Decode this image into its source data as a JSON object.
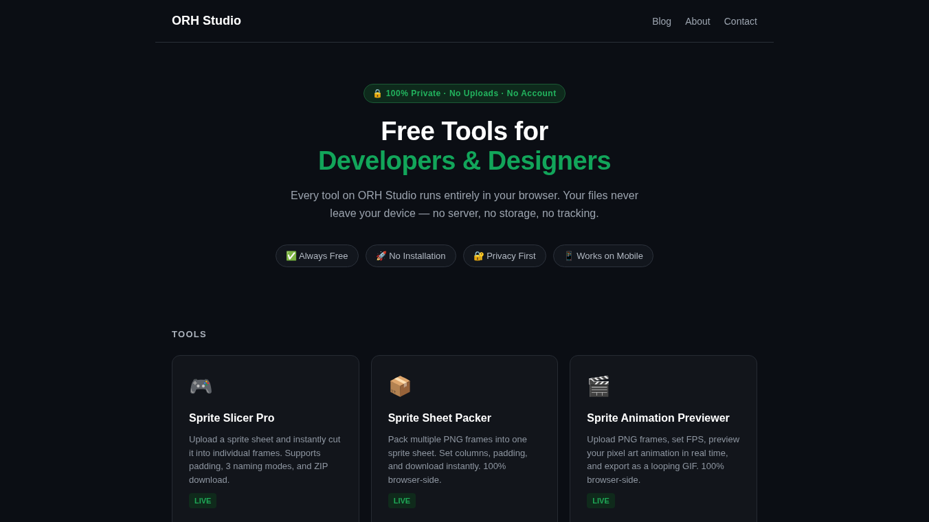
{
  "header": {
    "logo": "ORH Studio",
    "nav": [
      "Blog",
      "About",
      "Contact"
    ]
  },
  "hero": {
    "badge": "🔒 100% Private · No Uploads · No Account",
    "title": "Free Tools for",
    "title_accent": "Developers & Designers",
    "lead": "Every tool on ORH Studio runs entirely in your browser. Your files never leave your device — no server, no storage, no tracking.",
    "pills": [
      "✅ Always Free",
      "🚀 No Installation",
      "🔐 Privacy First",
      "📱 Works on Mobile"
    ]
  },
  "tools": {
    "heading": "TOOLS",
    "cards": [
      {
        "icon": "🎮",
        "title": "Sprite Slicer Pro",
        "description": "Upload a sprite sheet and instantly cut it into individual frames. Supports padding, 3 naming modes, and ZIP download.",
        "status": "LIVE"
      },
      {
        "icon": "📦",
        "title": "Sprite Sheet Packer",
        "description": "Pack multiple PNG frames into one sprite sheet. Set columns, padding, and download instantly. 100% browser-side.",
        "status": "LIVE"
      },
      {
        "icon": "🎬",
        "title": "Sprite Animation Previewer",
        "description": "Upload PNG frames, set FPS, preview your pixel art animation in real time, and export as a looping GIF. 100% browser-side.",
        "status": "LIVE"
      }
    ]
  }
}
